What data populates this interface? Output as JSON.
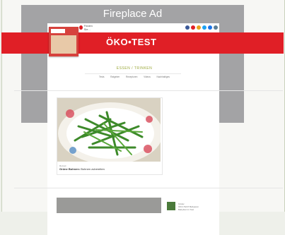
{
  "ad": {
    "label": "Fireplace Ad"
  },
  "header": {
    "search_label": "Finden Sie...",
    "logo": "ÖKO•TEST",
    "social_colors": [
      "#3b5998",
      "#e01f26",
      "#e9a21e",
      "#1da1f2",
      "#1a73e8",
      "#5b7e96"
    ]
  },
  "section": {
    "breadcrumb": "ESSEN / TRINKEN",
    "nav": [
      "Tests",
      "Ratgeber",
      "Rezepturen",
      "Videos",
      "Nachhaltiges"
    ]
  },
  "article": {
    "kicker": "Rezept",
    "title": "Grüne Bohnen:",
    "subtitle": "Bohnen zubereiten"
  },
  "side_item": {
    "kicker": "Kinder",
    "text": "ÖKO-TEST Babykost: Babybrei im Test"
  },
  "colors": {
    "brand_red": "#e01f26",
    "ad_gray": "#a3a3a5",
    "breadcrumb_green": "#9aa83a"
  }
}
